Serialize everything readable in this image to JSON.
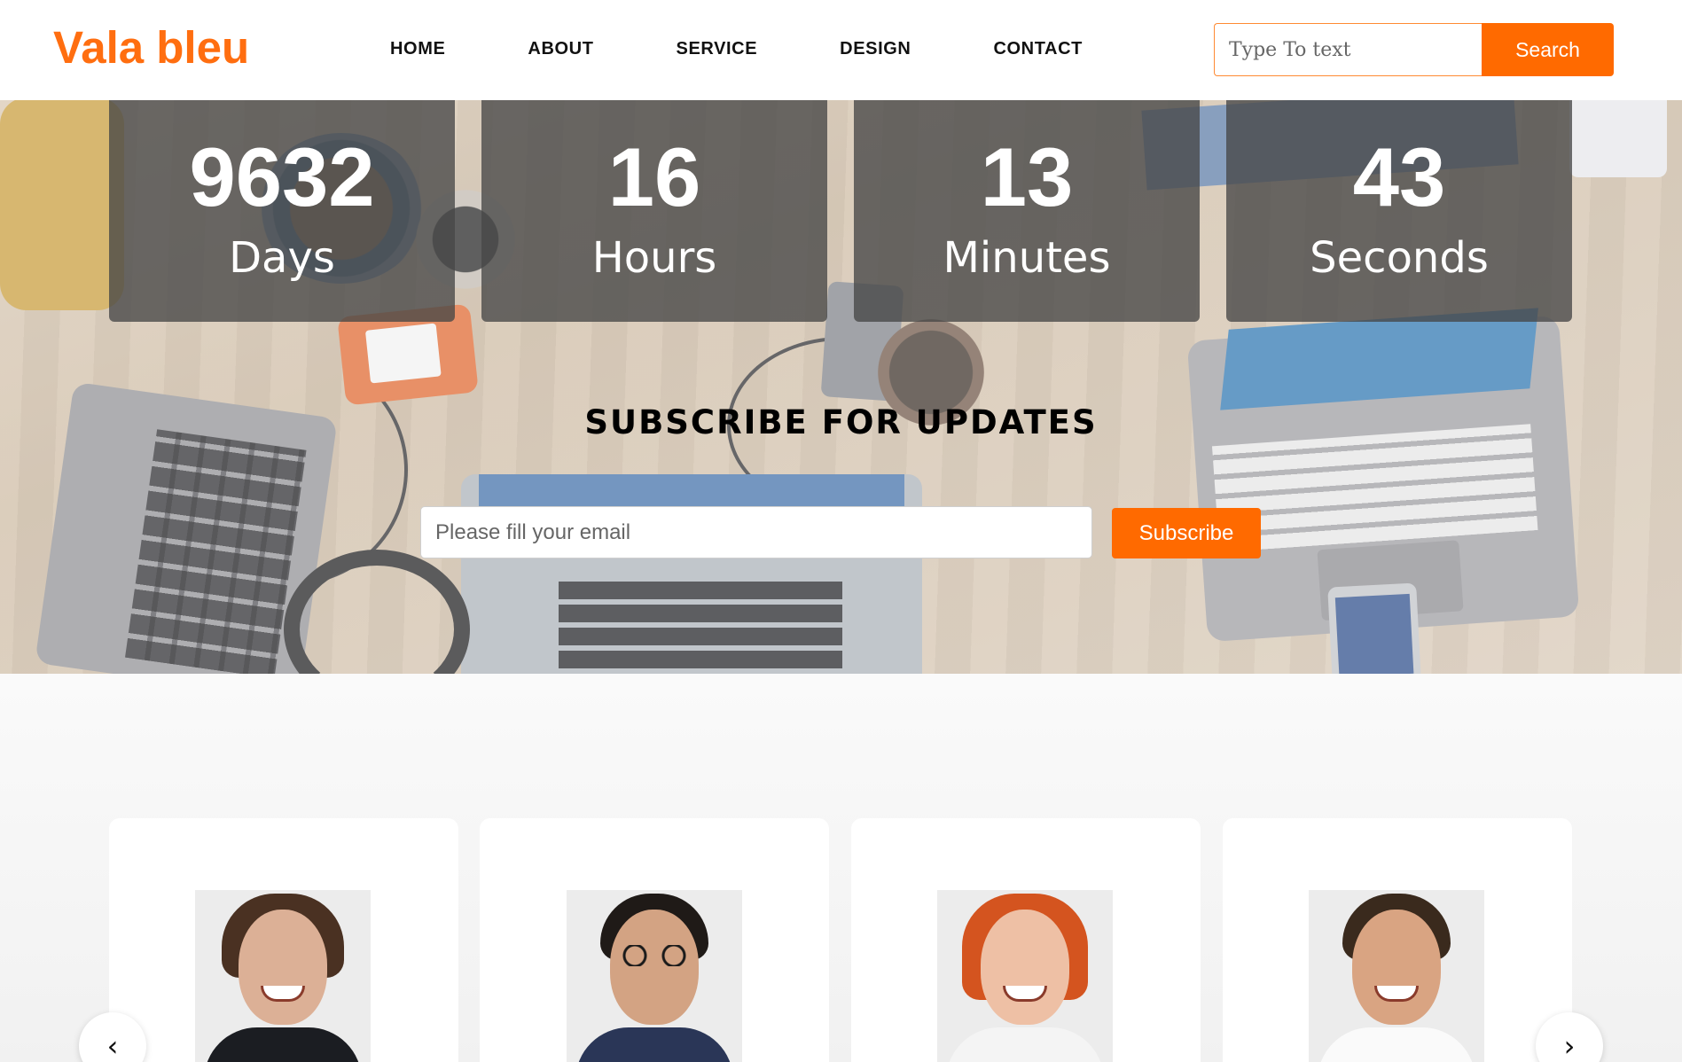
{
  "brand": {
    "name": "Vala bleu",
    "color": "#ff6e10"
  },
  "nav": {
    "items": [
      {
        "label": "HOME"
      },
      {
        "label": "ABOUT"
      },
      {
        "label": "SERVICE"
      },
      {
        "label": "DESIGN"
      },
      {
        "label": "CONTACT"
      }
    ]
  },
  "search": {
    "placeholder": "Type To text",
    "button_label": "Search"
  },
  "countdown": [
    {
      "value": "9632",
      "label": "Days"
    },
    {
      "value": "16",
      "label": "Hours"
    },
    {
      "value": "13",
      "label": "Minutes"
    },
    {
      "value": "43",
      "label": "Seconds"
    }
  ],
  "subscribe": {
    "title": "SUBSCRIBE FOR UPDATES",
    "placeholder": "Please fill your email",
    "button_label": "Subscribe"
  },
  "carousel": {
    "prev_icon": "chevron-left-icon",
    "next_icon": "chevron-right-icon",
    "prev_glyph": "‹",
    "next_glyph": "›"
  },
  "colors": {
    "accent": "#ff6a00",
    "nav_text": "#111111",
    "countdown_bg": "#464646"
  }
}
